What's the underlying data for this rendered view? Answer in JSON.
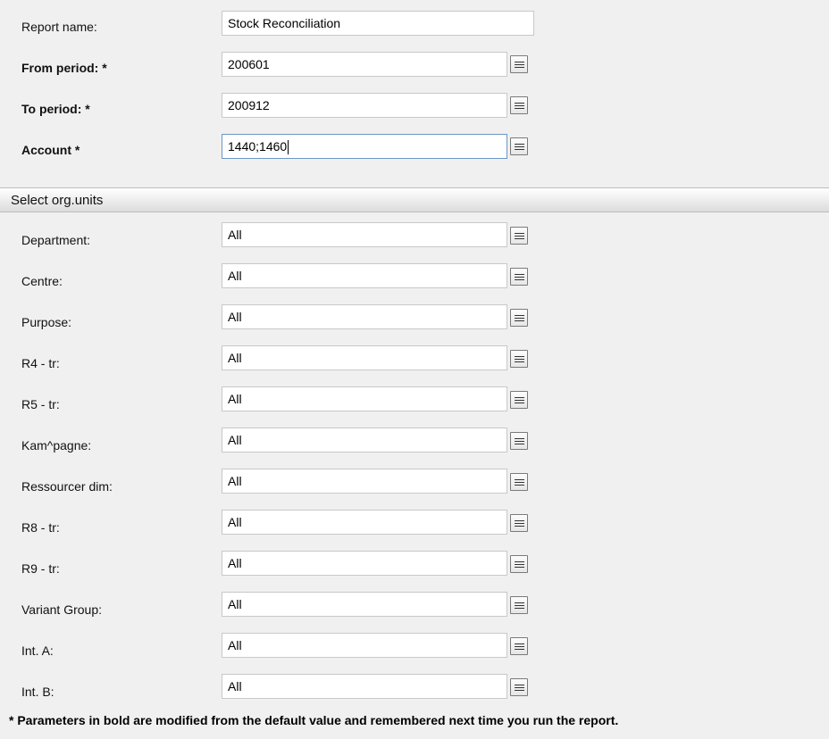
{
  "top_params": [
    {
      "label": "Report name:",
      "value": "Stock Reconciliation",
      "bold": false,
      "lookup": false
    },
    {
      "label": "From period: *",
      "value": "200601",
      "bold": true,
      "lookup": true
    },
    {
      "label": "To period: *",
      "value": "200912",
      "bold": true,
      "lookup": true
    },
    {
      "label": "Account *",
      "value": "1440;1460",
      "bold": true,
      "lookup": true,
      "focused": true
    }
  ],
  "section_title": "Select org.units",
  "org_units": [
    {
      "label": "Department:",
      "value": "All"
    },
    {
      "label": "Centre:",
      "value": "All"
    },
    {
      "label": "Purpose:",
      "value": "All"
    },
    {
      "label": "R4 - tr:",
      "value": "All"
    },
    {
      "label": "R5 - tr:",
      "value": "All"
    },
    {
      "label": "Kam^pagne:",
      "value": "All"
    },
    {
      "label": "Ressourcer dim:",
      "value": "All"
    },
    {
      "label": "R8 - tr:",
      "value": "All"
    },
    {
      "label": "R9 - tr:",
      "value": "All"
    },
    {
      "label": "Variant Group:",
      "value": "All"
    },
    {
      "label": "Int. A:",
      "value": "All"
    },
    {
      "label": "Int. B:",
      "value": "All"
    }
  ],
  "footnote": "* Parameters in bold are modified from the default value and remembered next time you run the report."
}
